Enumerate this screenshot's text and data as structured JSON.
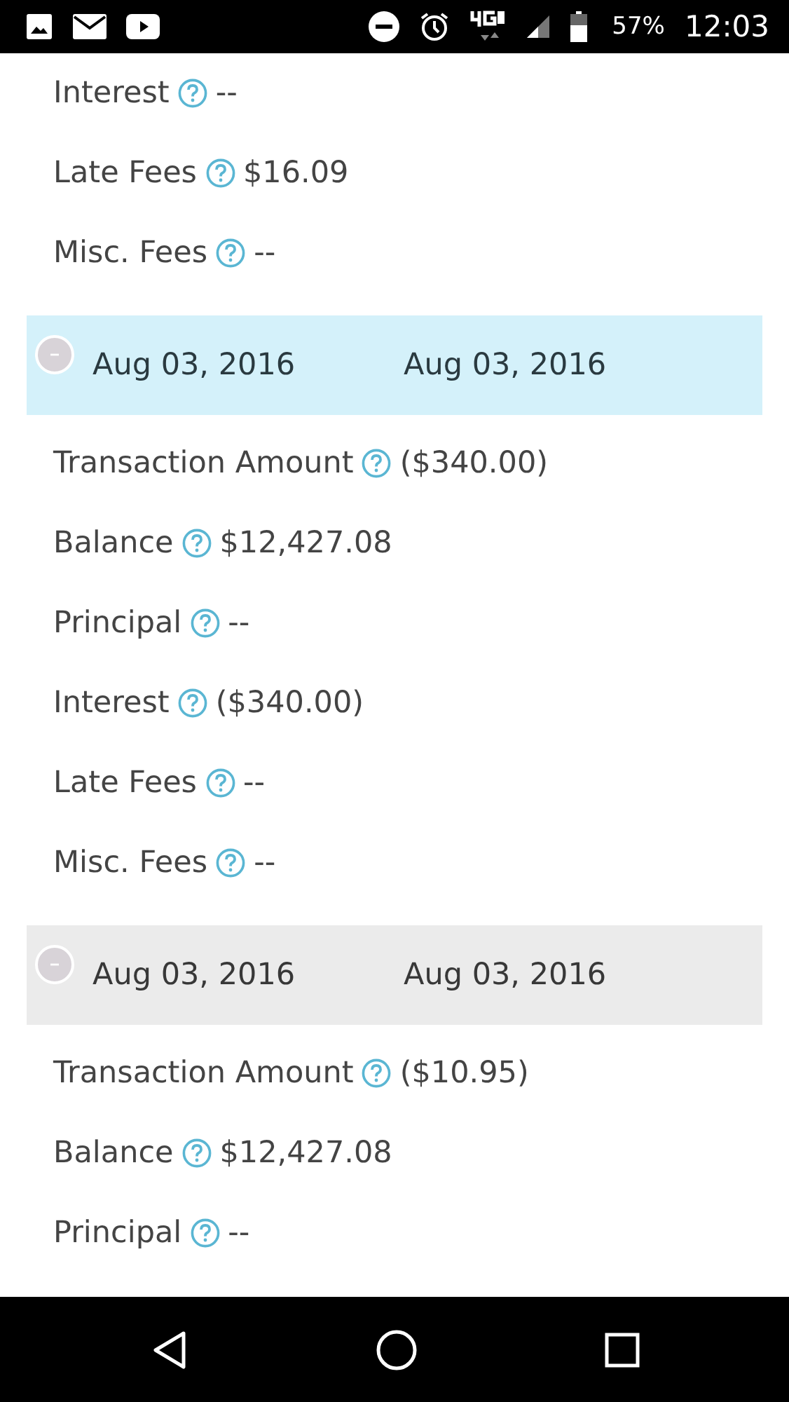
{
  "status_bar": {
    "battery": "57%",
    "time": "12:03"
  },
  "rows": [
    {
      "kind": "field",
      "label": "Interest",
      "value": "--"
    },
    {
      "kind": "field",
      "label": "Late Fees",
      "value": "$16.09"
    },
    {
      "kind": "field",
      "label": "Misc. Fees",
      "value": "--"
    },
    {
      "kind": "group",
      "date_1": "Aug 03, 2016",
      "date_2": "Aug 03, 2016",
      "selected": true
    },
    {
      "kind": "field",
      "label": "Transaction Amount",
      "value": "($340.00)"
    },
    {
      "kind": "field",
      "label": "Balance",
      "value": "$12,427.08"
    },
    {
      "kind": "field",
      "label": "Principal",
      "value": "--"
    },
    {
      "kind": "field",
      "label": "Interest",
      "value": "($340.00)"
    },
    {
      "kind": "field",
      "label": "Late Fees",
      "value": "--"
    },
    {
      "kind": "field",
      "label": "Misc. Fees",
      "value": "--"
    },
    {
      "kind": "group",
      "date_1": "Aug 03, 2016",
      "date_2": "Aug 03, 2016",
      "selected": false
    },
    {
      "kind": "field",
      "label": "Transaction Amount",
      "value": "($10.95)"
    },
    {
      "kind": "field",
      "label": "Balance",
      "value": "$12,427.08"
    },
    {
      "kind": "field",
      "label": "Principal",
      "value": "--"
    }
  ]
}
